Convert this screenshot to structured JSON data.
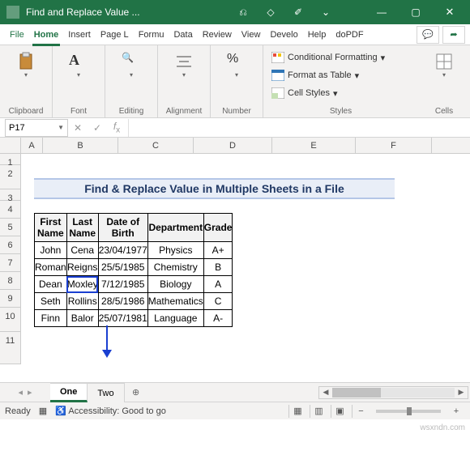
{
  "title": "Find and Replace Value ...",
  "window_btns": {
    "min": "—",
    "max": "▢",
    "close": "✕"
  },
  "titlebar_center_icons": [
    "⎌",
    "◇",
    "✐",
    "⌄"
  ],
  "tabs": {
    "file": "File",
    "items": [
      "Home",
      "Insert",
      "Page L",
      "Formu",
      "Data",
      "Review",
      "View",
      "Develo",
      "Help",
      "doPDF"
    ],
    "active": 0
  },
  "ribbon": {
    "clipboard": "Clipboard",
    "font": "Font",
    "editing": "Editing",
    "alignment": "Alignment",
    "number": "Number",
    "styles": "Styles",
    "cells": "Cells",
    "cond_fmt": "Conditional Formatting",
    "as_table": "Format as Table",
    "cell_styles": "Cell Styles"
  },
  "namebox": "P17",
  "columns": [
    "A",
    "B",
    "C",
    "D",
    "E",
    "F"
  ],
  "rows": [
    "1",
    "2",
    "3",
    "4",
    "5",
    "6",
    "7",
    "8",
    "9",
    "10",
    "11"
  ],
  "sheet_title": "Find & Replace Value in Multiple Sheets in a File",
  "headers": [
    "First Name",
    "Last Name",
    "Date of Birth",
    "Department",
    "Grade"
  ],
  "table": [
    [
      "John",
      "Cena",
      "23/04/1977",
      "Physics",
      "A+"
    ],
    [
      "Roman",
      "Reigns",
      "25/5/1985",
      "Chemistry",
      "B"
    ],
    [
      "Dean",
      "Moxley",
      "7/12/1985",
      "Biology",
      "A"
    ],
    [
      "Seth",
      "Rollins",
      "28/5/1986",
      "Mathematics",
      "C"
    ],
    [
      "Finn",
      "Balor",
      "25/07/1981",
      "Language",
      "A-"
    ]
  ],
  "sheet_tabs": {
    "active": "One",
    "inactive": "Two"
  },
  "status": {
    "ready": "Ready",
    "accessibility": "Accessibility: Good to go",
    "zoom_minus": "−",
    "zoom_plus": "+"
  },
  "watermark": "wsxndn.com"
}
